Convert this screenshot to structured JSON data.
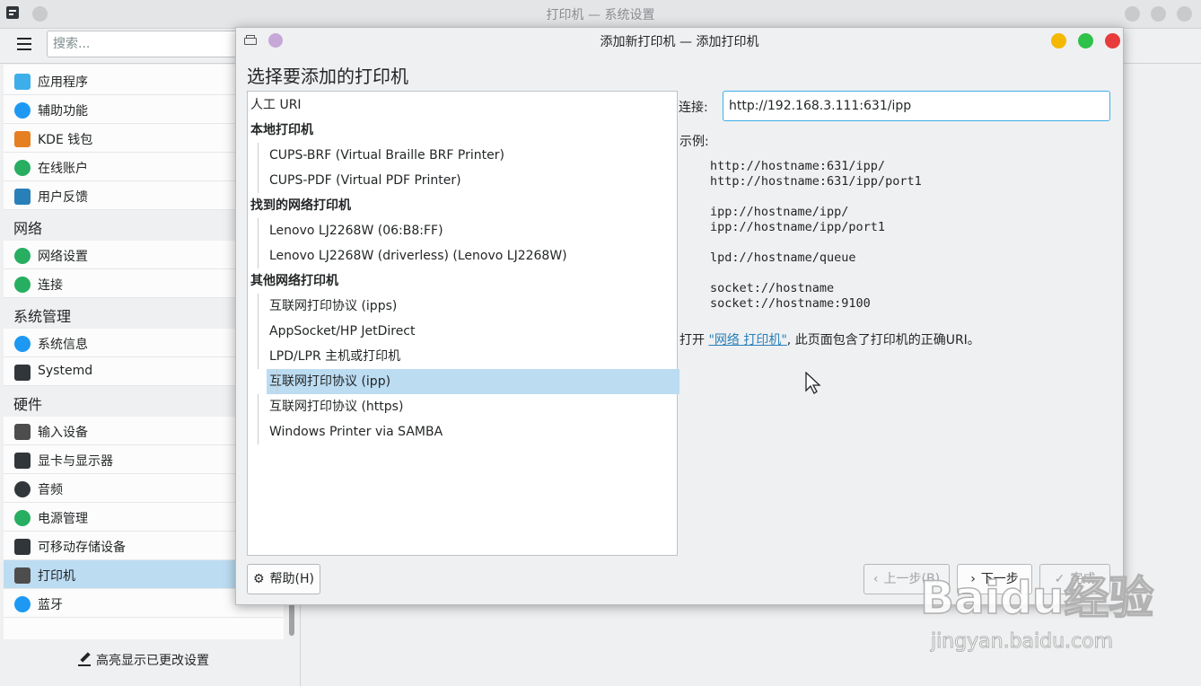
{
  "background_window": {
    "title": "打印机 — 系统设置",
    "search_placeholder": "搜索...",
    "sidebar": {
      "items": [
        {
          "type": "item",
          "label": "应用程序",
          "icon": "applications-icon",
          "color": "#3daee9"
        },
        {
          "type": "item",
          "label": "辅助功能",
          "icon": "accessibility-icon",
          "color": "#1d99f3"
        },
        {
          "type": "item",
          "label": "KDE 钱包",
          "icon": "wallet-icon",
          "color": "#e67e22"
        },
        {
          "type": "item",
          "label": "在线账户",
          "icon": "globe-icon",
          "color": "#27ae60"
        },
        {
          "type": "item",
          "label": "用户反馈",
          "icon": "feedback-icon",
          "color": "#2980b9"
        },
        {
          "type": "category",
          "label": "网络"
        },
        {
          "type": "item",
          "label": "网络设置",
          "icon": "globe-icon",
          "color": "#27ae60"
        },
        {
          "type": "item",
          "label": "连接",
          "icon": "globe-icon",
          "color": "#27ae60"
        },
        {
          "type": "category",
          "label": "系统管理"
        },
        {
          "type": "item",
          "label": "系统信息",
          "icon": "info-icon",
          "color": "#1d99f3"
        },
        {
          "type": "item",
          "label": "Systemd",
          "icon": "systemd-icon",
          "color": "#31363b"
        },
        {
          "type": "category",
          "label": "硬件"
        },
        {
          "type": "item",
          "label": "输入设备",
          "icon": "keyboard-icon",
          "color": "#4d4d4d"
        },
        {
          "type": "item",
          "label": "显卡与显示器",
          "icon": "monitor-icon",
          "color": "#31363b"
        },
        {
          "type": "item",
          "label": "音频",
          "icon": "speaker-icon",
          "color": "#31363b"
        },
        {
          "type": "item",
          "label": "电源管理",
          "icon": "power-icon",
          "color": "#27ae60"
        },
        {
          "type": "item",
          "label": "可移动存储设备",
          "icon": "usb-icon",
          "color": "#31363b"
        },
        {
          "type": "item",
          "label": "打印机",
          "icon": "printer-icon",
          "color": "#4d4d4d",
          "active": true
        },
        {
          "type": "item",
          "label": "蓝牙",
          "icon": "bluetooth-icon",
          "color": "#1d99f3"
        }
      ]
    },
    "highlight_button": "高亮显示已更改设置"
  },
  "dialog": {
    "title": "添加新打印机 — 添加打印机",
    "heading": "选择要添加的打印机",
    "list": [
      {
        "kind": "plain",
        "label": "人工 URI"
      },
      {
        "kind": "group",
        "label": "本地打印机"
      },
      {
        "kind": "child",
        "label": "CUPS-BRF (Virtual Braille BRF Printer)"
      },
      {
        "kind": "child",
        "label": "CUPS-PDF (Virtual PDF Printer)"
      },
      {
        "kind": "group",
        "label": "找到的网络打印机"
      },
      {
        "kind": "child",
        "label": "Lenovo LJ2268W (06:B8:FF)"
      },
      {
        "kind": "child",
        "label": "Lenovo LJ2268W (driverless) (Lenovo LJ2268W)"
      },
      {
        "kind": "group",
        "label": "其他网络打印机"
      },
      {
        "kind": "child",
        "label": "互联网打印协议 (ipps)"
      },
      {
        "kind": "child",
        "label": "AppSocket/HP JetDirect"
      },
      {
        "kind": "child",
        "label": "LPD/LPR 主机或打印机"
      },
      {
        "kind": "child",
        "label": "互联网打印协议 (ipp)",
        "selected": true
      },
      {
        "kind": "child",
        "label": "互联网打印协议 (https)"
      },
      {
        "kind": "child",
        "label": "Windows Printer via SAMBA"
      }
    ],
    "connection_label": "连接:",
    "connection_value": "http://192.168.3.111:631/ipp",
    "examples_label": "示例:",
    "examples": [
      "http://hostname:631/ipp/",
      "http://hostname:631/ipp/port1",
      "",
      "ipp://hostname/ipp/",
      "ipp://hostname/ipp/port1",
      "",
      "lpd://hostname/queue",
      "",
      "socket://hostname",
      "socket://hostname:9100"
    ],
    "note_prefix": "打开 ",
    "note_link": "\"网络 打印机\"",
    "note_suffix": ", 此页面包含了打印机的正确URI。",
    "help_button": "帮助(H)",
    "back_button": "上一步(B)",
    "next_button": "下一步",
    "finish_button": "完成",
    "window_button_colors": {
      "minimize": "#f4b800",
      "maximize": "#2ec24a",
      "close": "#e83b3b"
    }
  },
  "watermark": {
    "text": "Baidu经验",
    "sub": "jingyan.baidu.com"
  }
}
